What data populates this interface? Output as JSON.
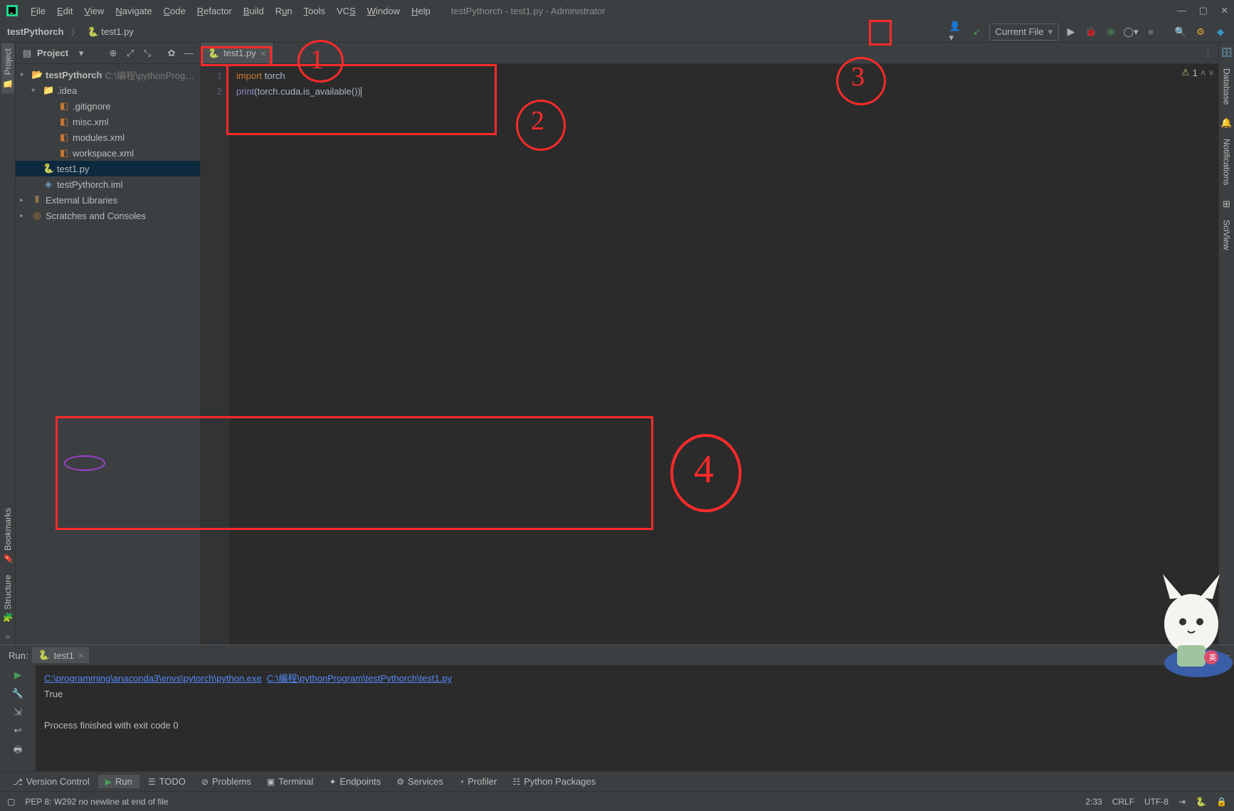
{
  "window": {
    "title": "testPythorch - test1.py - Administrator"
  },
  "menu": [
    "File",
    "Edit",
    "View",
    "Navigate",
    "Code",
    "Refactor",
    "Build",
    "Run",
    "Tools",
    "VCS",
    "Window",
    "Help"
  ],
  "breadcrumb": {
    "project": "testPythorch",
    "file": "test1.py"
  },
  "toolbar": {
    "config": "Current File"
  },
  "sidebar": {
    "title": "Project",
    "root": {
      "name": "testPythorch",
      "path": "C:\\编程\\pythonProg…"
    },
    "idea": ".idea",
    "files": [
      ".gitignore",
      "misc.xml",
      "modules.xml",
      "workspace.xml"
    ],
    "test1": "test1.py",
    "iml": "testPythorch.iml",
    "ext": "External Libraries",
    "scratch": "Scratches and Consoles"
  },
  "editor": {
    "tab": "test1.py",
    "lines": [
      "1",
      "2"
    ],
    "code": {
      "l1": {
        "import": "import",
        "torch": "torch"
      },
      "l2": {
        "print": "print",
        "rest_open": "(",
        "mid": "torch.cuda.is_available()",
        "close": ")"
      }
    },
    "inspection": {
      "warn_count": "1"
    }
  },
  "run": {
    "label": "Run:",
    "tab": "test1",
    "path1": "C:\\programming\\anaconda3\\envs\\pytorch\\python.exe",
    "path2": "C:\\编程\\pythonProgram\\testPythorch\\test1.py",
    "out": "True",
    "exit": "Process finished with exit code 0"
  },
  "bottom": {
    "vcs": "Version Control",
    "run": "Run",
    "todo": "TODO",
    "problems": "Problems",
    "terminal": "Terminal",
    "endpoints": "Endpoints",
    "services": "Services",
    "profiler": "Profiler",
    "pkgs": "Python Packages"
  },
  "status": {
    "msg": "PEP 8: W292 no newline at end of file",
    "pos": "2:33",
    "eol": "CRLF",
    "enc": "UTF-8"
  },
  "left_tabs": {
    "project": "Project",
    "bookmarks": "Bookmarks",
    "structure": "Structure"
  },
  "right_tabs": {
    "db": "Database",
    "notif": "Notifications",
    "sci": "SciView"
  }
}
